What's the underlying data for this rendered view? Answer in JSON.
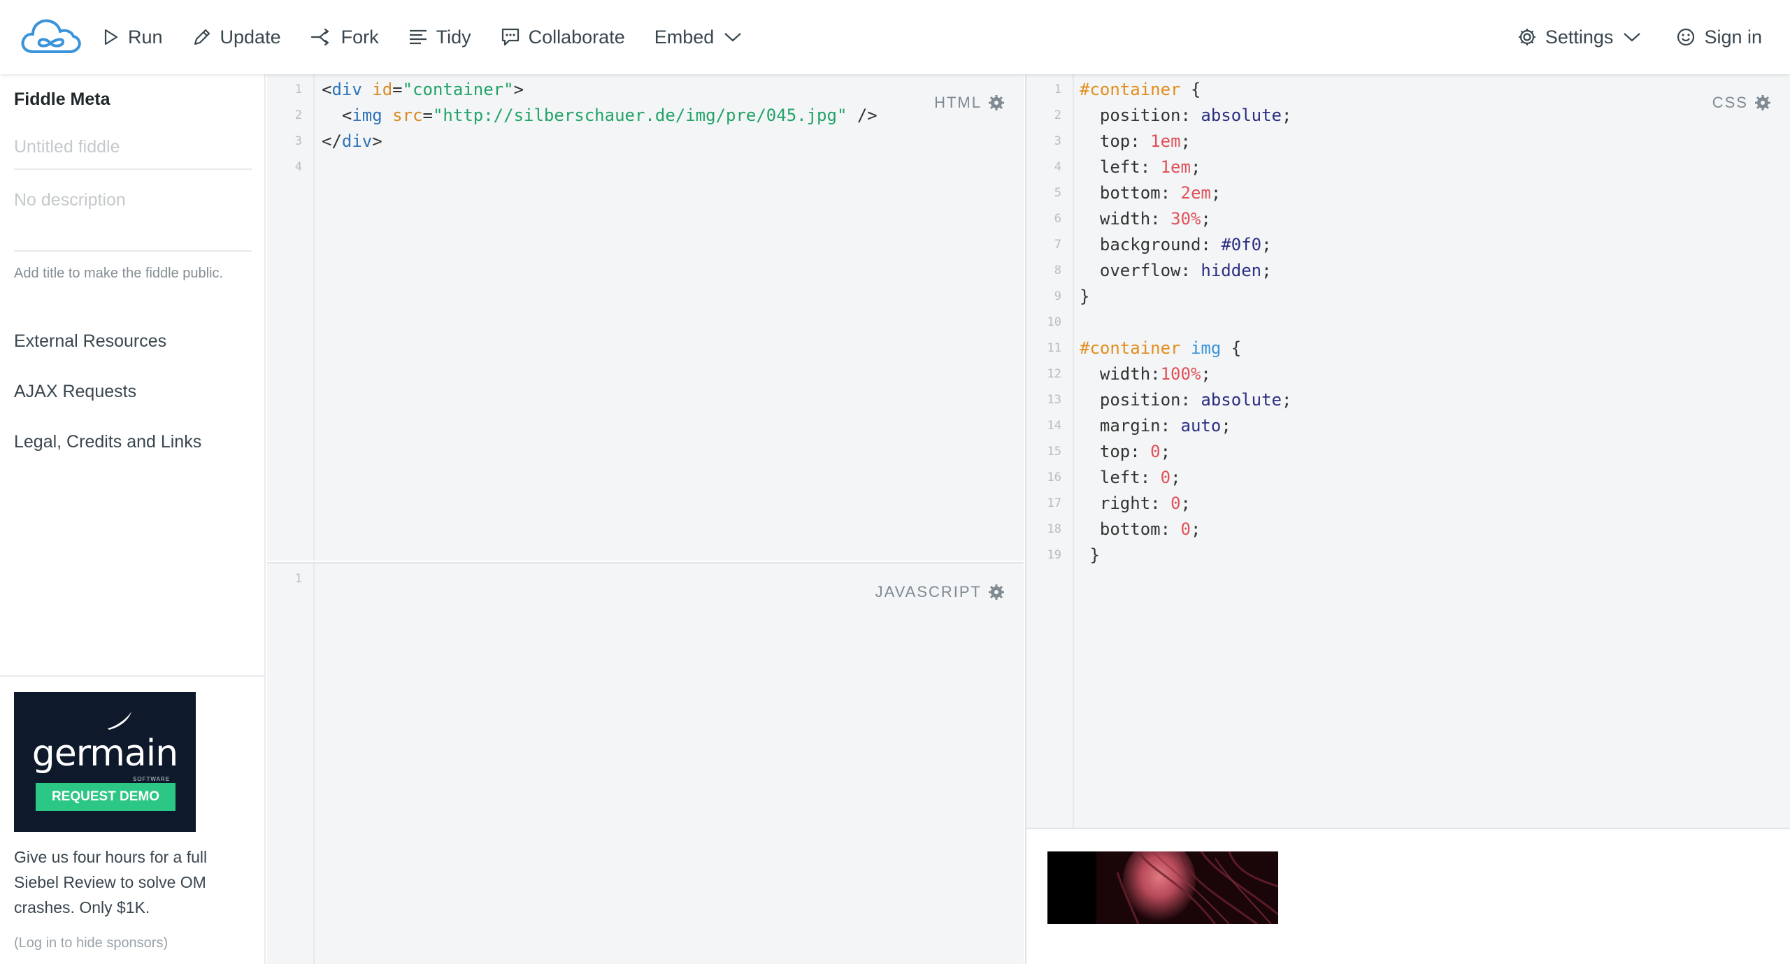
{
  "header": {
    "logo_icon": "jsfiddle-cloud-logo-icon",
    "nav": [
      {
        "label": "Run",
        "icon": "play-icon"
      },
      {
        "label": "Update",
        "icon": "pencil-icon"
      },
      {
        "label": "Fork",
        "icon": "fork-icon"
      },
      {
        "label": "Tidy",
        "icon": "tidy-lines-icon"
      },
      {
        "label": "Collaborate",
        "icon": "chat-bubble-icon"
      },
      {
        "label": "Embed",
        "icon": "chevron-down-icon"
      }
    ],
    "settings_label": "Settings",
    "signin_label": "Sign in"
  },
  "sidebar": {
    "meta_title": "Fiddle Meta",
    "title_placeholder": "Untitled fiddle",
    "desc_placeholder": "No description",
    "hint": "Add title to make the fiddle public.",
    "links": [
      "External Resources",
      "AJAX Requests",
      "Legal, Credits and Links"
    ],
    "sponsor": {
      "brand": "germain",
      "brand_sub": "SOFTWARE",
      "button": "REQUEST DEMO",
      "text": "Give us four hours for a full Siebel Review to solve OM crashes. Only $1K.",
      "hide": "(Log in to hide sponsors)"
    }
  },
  "editors": {
    "html_label": "HTML",
    "js_label": "JAVASCRIPT",
    "css_label": "CSS",
    "html_line_count": 4,
    "js_line_count": 1,
    "css_line_count": 19
  },
  "colors": {
    "accent_blue": "#3b94d9",
    "ad_green": "#2cc685",
    "ad_navy": "#0e1a2b"
  }
}
